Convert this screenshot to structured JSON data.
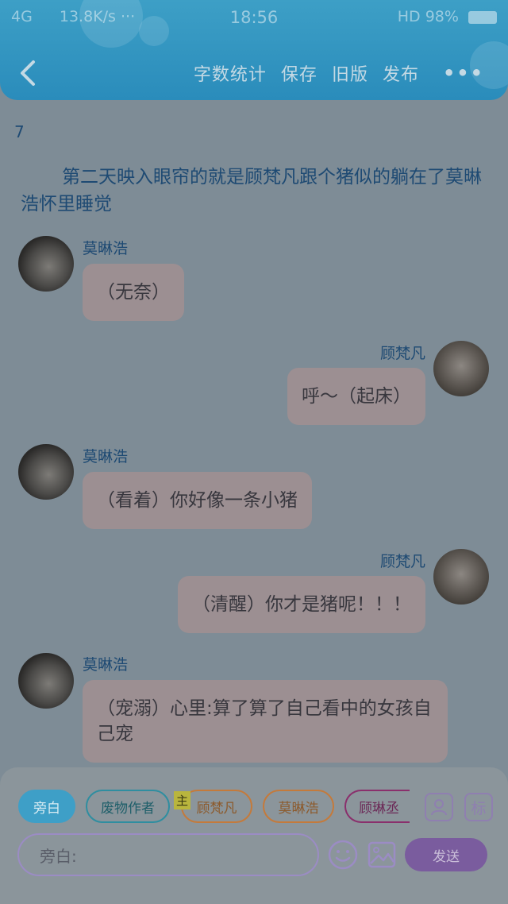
{
  "status_bar": {
    "network": "4G",
    "speed": "13.8K/s",
    "dots": "···",
    "time": "18:56",
    "right": "HD 98%"
  },
  "nav": {
    "save_label": "保存",
    "word_count_label": "字数统计",
    "old_version_label": "旧版",
    "publish_label": "发布",
    "more_label": "•••"
  },
  "chapter_number": "7",
  "narration": "第二天映入眼帘的就是顾梵凡跟个猪似的躺在了莫晽浩怀里睡觉",
  "messages": [
    {
      "side": "left",
      "name": "莫晽浩",
      "text": "（无奈）"
    },
    {
      "side": "right",
      "name": "顾梵凡",
      "text": "呼～（起床）"
    },
    {
      "side": "left",
      "name": "莫晽浩",
      "text": "（看着）你好像一条小猪"
    },
    {
      "side": "right",
      "name": "顾梵凡",
      "text": "（清醒）你才是猪呢！！！"
    },
    {
      "side": "left",
      "name": "莫晽浩",
      "text": "（宠溺）心里:算了算了自己看中的女孩自己宠"
    }
  ],
  "roles": {
    "narration": "旁白",
    "author": "废物作者",
    "main_tag": "主",
    "role1": "顾梵凡",
    "role2": "莫晽浩",
    "role3": "顾琳丞"
  },
  "tools": {
    "portrait_label": "portrait-icon",
    "tag_label": "标"
  },
  "input": {
    "value": "旁白:"
  },
  "send_label": "发送",
  "colors": {
    "header": "#2a8cbb",
    "send": "#7a5c9e",
    "bubble": "#9c8f92"
  }
}
